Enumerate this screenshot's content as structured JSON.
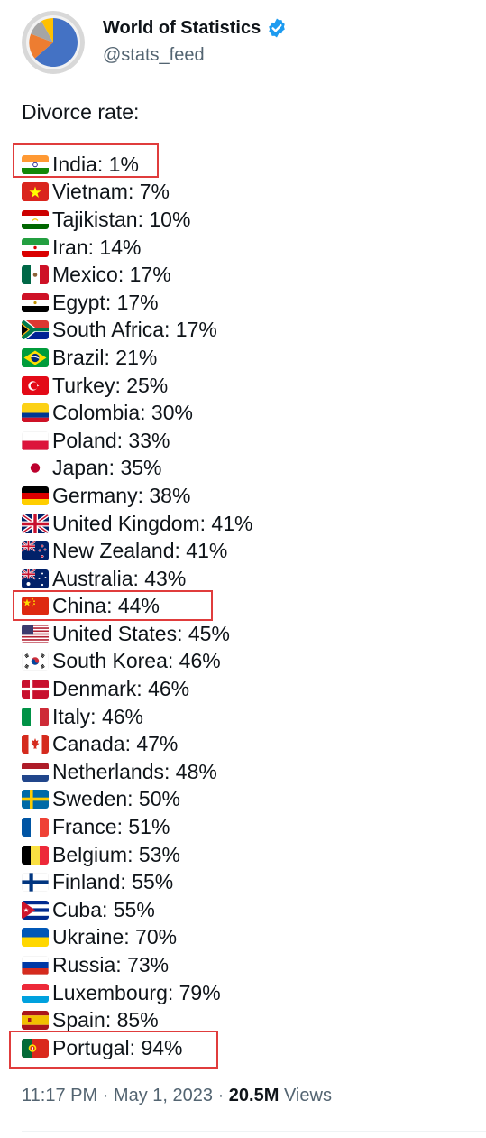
{
  "author": {
    "name": "World of Statistics",
    "handle": "@stats_feed",
    "avatar": "avatar-pie-chart-icon",
    "verified_icon": "verified-badge-icon",
    "accent": "#1d9bf0"
  },
  "tweet": {
    "intro": "Divorce rate:",
    "items": [
      {
        "flag": "india",
        "text": "India: 1%",
        "highlighted": true
      },
      {
        "flag": "vietnam",
        "text": "Vietnam: 7%"
      },
      {
        "flag": "tajikistan",
        "text": "Tajikistan: 10%"
      },
      {
        "flag": "iran",
        "text": "Iran: 14%"
      },
      {
        "flag": "mexico",
        "text": "Mexico: 17%"
      },
      {
        "flag": "egypt",
        "text": "Egypt: 17%"
      },
      {
        "flag": "south-africa",
        "text": "South Africa: 17%"
      },
      {
        "flag": "brazil",
        "text": "Brazil: 21%"
      },
      {
        "flag": "turkey",
        "text": "Turkey: 25%"
      },
      {
        "flag": "colombia",
        "text": "Colombia: 30%"
      },
      {
        "flag": "poland",
        "text": "Poland: 33%"
      },
      {
        "flag": "japan",
        "text": "Japan: 35%"
      },
      {
        "flag": "germany",
        "text": "Germany: 38%"
      },
      {
        "flag": "united-kingdom",
        "text": "United Kingdom: 41%"
      },
      {
        "flag": "new-zealand",
        "text": "New Zealand: 41%"
      },
      {
        "flag": "australia",
        "text": "Australia: 43%"
      },
      {
        "flag": "china",
        "text": "China: 44%",
        "highlighted": true
      },
      {
        "flag": "united-states",
        "text": "United States: 45%"
      },
      {
        "flag": "south-korea",
        "text": "South Korea: 46%"
      },
      {
        "flag": "denmark",
        "text": "Denmark: 46%"
      },
      {
        "flag": "italy",
        "text": "Italy: 46%"
      },
      {
        "flag": "canada",
        "text": "Canada: 47%"
      },
      {
        "flag": "netherlands",
        "text": "Netherlands: 48%"
      },
      {
        "flag": "sweden",
        "text": "Sweden: 50%"
      },
      {
        "flag": "france",
        "text": "France: 51%"
      },
      {
        "flag": "belgium",
        "text": "Belgium: 53%"
      },
      {
        "flag": "finland",
        "text": "Finland: 55%"
      },
      {
        "flag": "cuba",
        "text": "Cuba: 55%"
      },
      {
        "flag": "ukraine",
        "text": "Ukraine: 70%"
      },
      {
        "flag": "russia",
        "text": "Russia: 73%"
      },
      {
        "flag": "luxembourg",
        "text": "Luxembourg: 79%"
      },
      {
        "flag": "spain",
        "text": "Spain: 85%"
      },
      {
        "flag": "portugal",
        "text": "Portugal: 94%",
        "highlighted": true
      }
    ],
    "highlight_color": "#e03c3c"
  },
  "meta": {
    "time": "11:17 PM",
    "separator": "·",
    "date": "May 1, 2023",
    "views_count": "20.5M",
    "views_label": "Views"
  }
}
